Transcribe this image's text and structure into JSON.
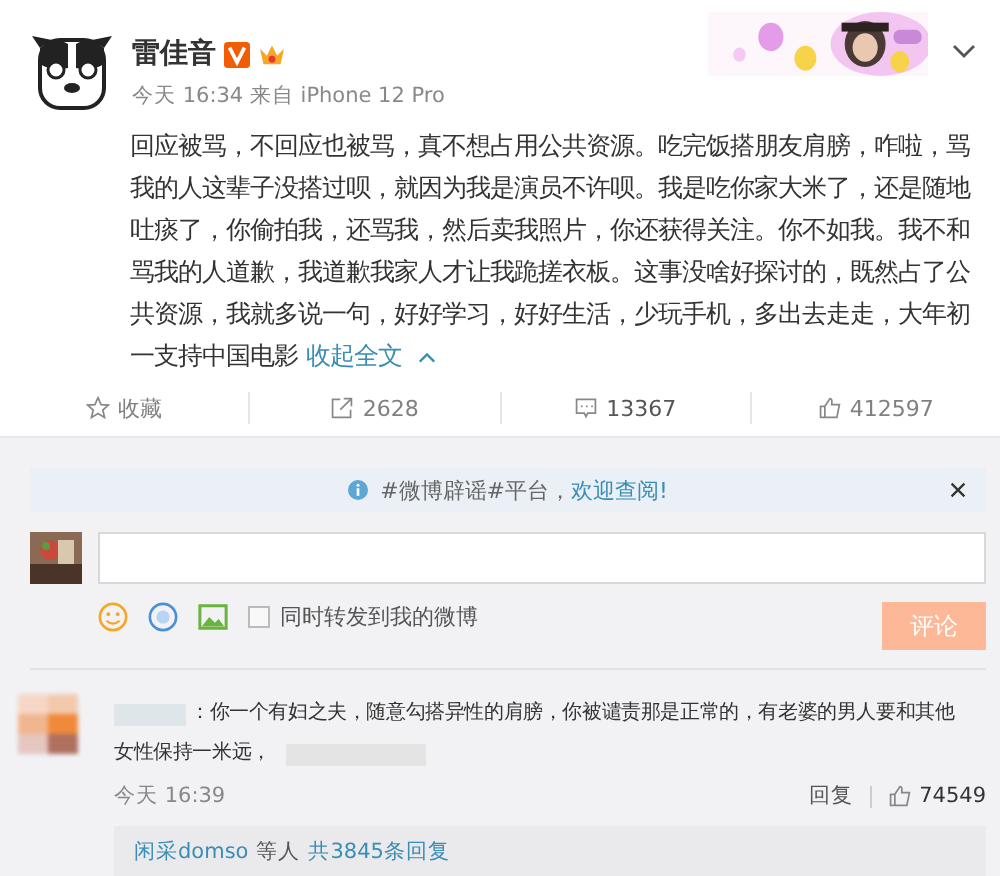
{
  "post": {
    "author": "雷佳音",
    "meta": "今天 16:34 来自 iPhone 12 Pro",
    "text": "回应被骂，不回应也被骂，真不想占用公共资源。吃完饭搭朋友肩膀，咋啦，骂我的人这辈子没搭过呗，就因为我是演员不许呗。我是吃你家大米了，还是随地吐痰了，你偷拍我，还骂我，然后卖我照片，你还获得关注。你不如我。我不和骂我的人道歉，我道歉我家人才让我跪搓衣板。这事没啥好探讨的，既然占了公共资源，我就多说一句，好好学习，好好生活，少玩手机，多出去走走，大年初一支持中国电影",
    "collapse_link": "收起全文"
  },
  "actions": [
    {
      "kind": "favorite",
      "label": "收藏",
      "selected": false
    },
    {
      "kind": "repost",
      "label": "2628",
      "selected": false
    },
    {
      "kind": "comment",
      "label": "13367",
      "selected": true
    },
    {
      "kind": "like",
      "label": "412597",
      "selected": false
    }
  ],
  "notice": {
    "prefix": "#微博辟谣#平台，",
    "link": "欢迎查阅!"
  },
  "composer": {
    "repost_option": "同时转发到我的微博",
    "repost_checked": false,
    "submit": "评论"
  },
  "comments": [
    {
      "text_lines": [
        "：你一个有妇之夫，随意勾搭异性的肩膀，你被谴责那是正常的，有老婆的男人要和其他",
        "女性保持一米远，"
      ],
      "time": "今天 16:39",
      "reply": "回复",
      "likes": "74549",
      "replies_user": "闲采domso",
      "replies_mid": "等人",
      "replies_count": "共3845条回复"
    }
  ]
}
